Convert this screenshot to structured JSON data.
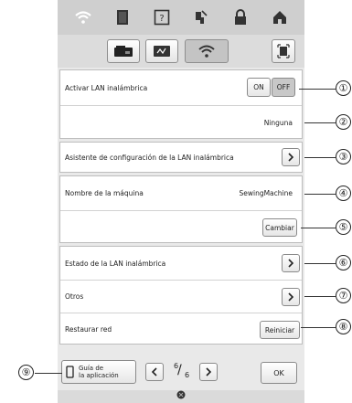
{
  "icons": {
    "top": [
      "wifi-icon",
      "document-icon",
      "help-icon",
      "threading-icon",
      "lock-icon",
      "home-icon"
    ],
    "modes": [
      "sewing-machine-icon",
      "embroidery-icon",
      "wifi-icon"
    ],
    "fit": "fit-screen-icon"
  },
  "rows": {
    "wlan_enable": {
      "label": "Activar LAN inalámbrica",
      "on": "ON",
      "off": "OFF",
      "selected": "OFF"
    },
    "network": {
      "value": "Ninguna"
    },
    "wizard": {
      "label": "Asistente de configuración de la LAN inalámbrica"
    },
    "machine_name": {
      "label": "Nombre de la máquina",
      "value": "SewingMachine"
    },
    "change": {
      "button": "Cambiar"
    },
    "status": {
      "label": "Estado de la LAN inalámbrica"
    },
    "others": {
      "label": "Otros"
    },
    "reset": {
      "label": "Restaurar red",
      "button": "Reiniciar"
    }
  },
  "bottom": {
    "guide_line1": "Guía de",
    "guide_line2": "la aplicación",
    "page_current": "6",
    "page_total": "6",
    "ok": "OK"
  },
  "callouts": [
    "①",
    "②",
    "③",
    "④",
    "⑤",
    "⑥",
    "⑦",
    "⑧",
    "⑨"
  ],
  "colors": {
    "background": "#e9e9e9",
    "topbar": "#cfcfcf",
    "selected": "#c8c8c8"
  }
}
